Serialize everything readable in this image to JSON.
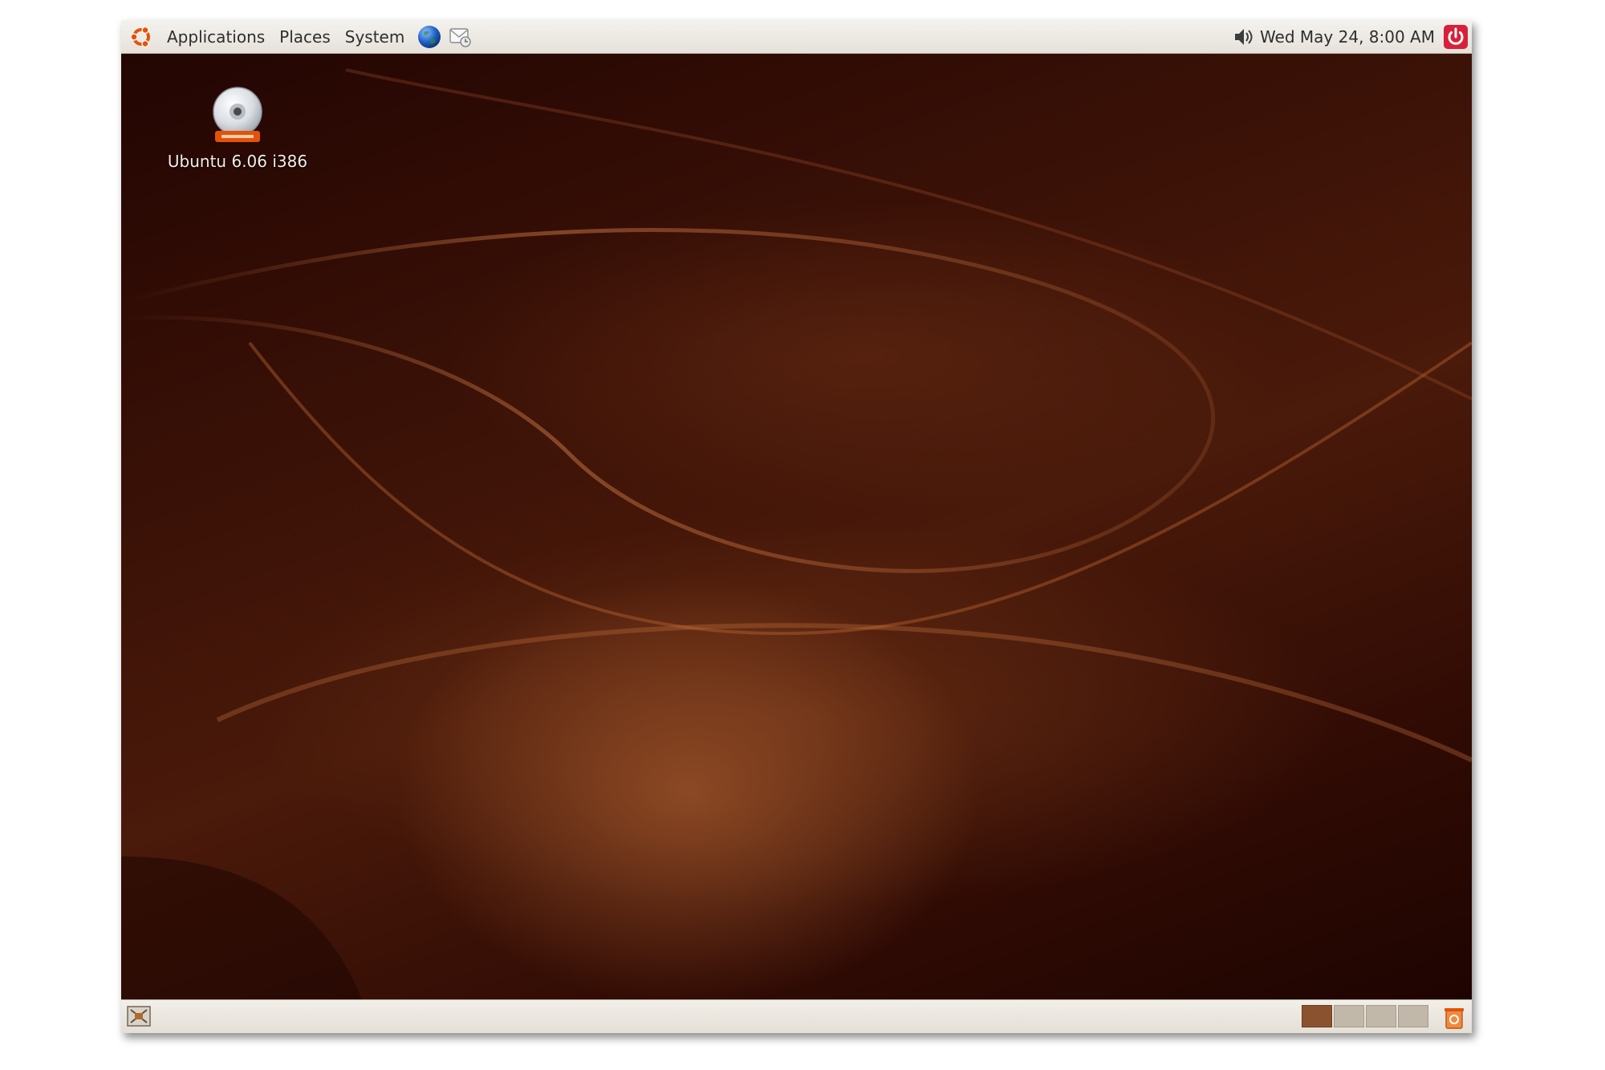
{
  "top_panel": {
    "menus": [
      "Applications",
      "Places",
      "System"
    ],
    "clock": "Wed May 24,  8:00 AM",
    "icons": {
      "logo": "ubuntu-logo-icon",
      "browser": "globe-icon",
      "email": "email-icon",
      "volume": "volume-icon",
      "logout": "logout-icon"
    }
  },
  "desktop": {
    "icons": [
      {
        "label": "Ubuntu 6.06 i386",
        "icon": "dvd-icon"
      }
    ]
  },
  "bottom_panel": {
    "workspaces": {
      "count": 4,
      "active_index": 0
    },
    "icons": {
      "show_desktop": "show-desktop-icon",
      "trash": "trash-icon"
    }
  },
  "colors": {
    "panel": "#ece9e2",
    "desktop_base": "#3c1207",
    "accent_orange": "#e2530a",
    "workspace_active": "#8b5230"
  }
}
